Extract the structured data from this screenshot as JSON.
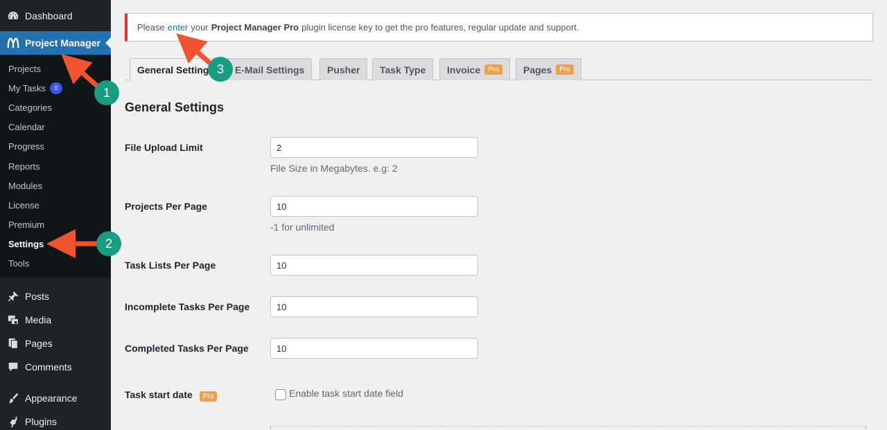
{
  "sidebar": {
    "dashboard": "Dashboard",
    "active": "Project Manager",
    "submenu": [
      {
        "label": "Projects"
      },
      {
        "label": "My Tasks",
        "badge": "0"
      },
      {
        "label": "Categories"
      },
      {
        "label": "Calendar"
      },
      {
        "label": "Progress"
      },
      {
        "label": "Reports"
      },
      {
        "label": "Modules"
      },
      {
        "label": "License"
      },
      {
        "label": "Premium"
      },
      {
        "label": "Settings"
      },
      {
        "label": "Tools"
      }
    ],
    "menu": [
      "Posts",
      "Media",
      "Pages",
      "Comments",
      "Appearance",
      "Plugins"
    ]
  },
  "notice": {
    "before": "Please",
    "link": "enter",
    "middle": "your",
    "product": "Project Manager Pro",
    "after": "plugin license key to get the pro features, regular update and support."
  },
  "tabs": [
    {
      "label": "General Settings"
    },
    {
      "label": "E-Mail Settings"
    },
    {
      "label": "Pusher"
    },
    {
      "label": "Task Type"
    },
    {
      "label": "Invoice",
      "pro": "Pro"
    },
    {
      "label": "Pages",
      "pro": "Pro"
    }
  ],
  "page_title": "General Settings",
  "fields": {
    "file_upload": {
      "label": "File Upload Limit",
      "value": "2",
      "desc": "File Size in Megabytes. e.g: 2"
    },
    "projects_per_page": {
      "label": "Projects Per Page",
      "value": "10",
      "desc": "-1 for unlimited"
    },
    "task_lists": {
      "label": "Task Lists Per Page",
      "value": "10"
    },
    "incomplete": {
      "label": "Incomplete Tasks Per Page",
      "value": "10"
    },
    "completed": {
      "label": "Completed Tasks Per Page",
      "value": "10"
    },
    "start_date": {
      "label": "Task start date",
      "pro": "Pro",
      "checkbox_label": "Enable task start date field"
    }
  },
  "annotations": {
    "step1": "1",
    "step2": "2",
    "step3": "3"
  },
  "colors": {
    "accent": "#2271b1",
    "arrow": "#f1532e",
    "step": "#1a9c82",
    "pro": "#f0a04b"
  }
}
